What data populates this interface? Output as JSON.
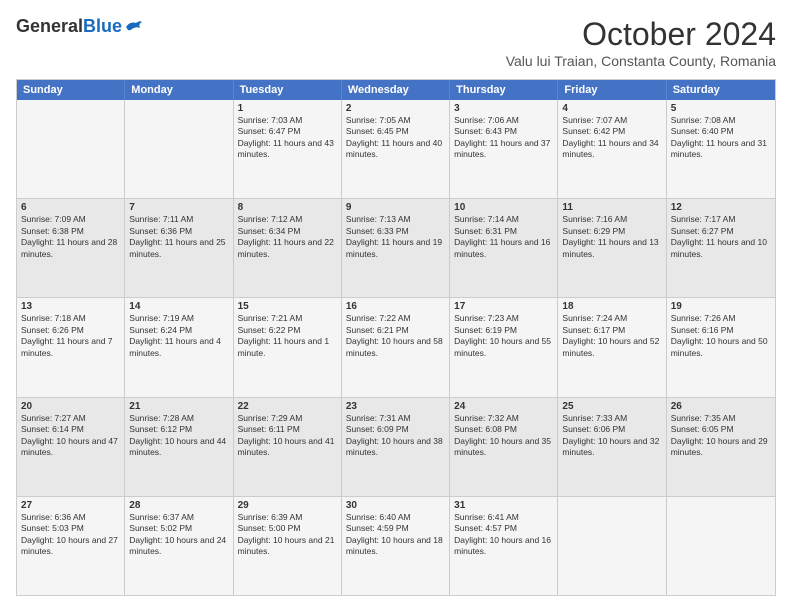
{
  "logo": {
    "general": "General",
    "blue": "Blue"
  },
  "title": "October 2024",
  "location": "Valu lui Traian, Constanta County, Romania",
  "headers": [
    "Sunday",
    "Monday",
    "Tuesday",
    "Wednesday",
    "Thursday",
    "Friday",
    "Saturday"
  ],
  "rows": [
    [
      {
        "day": "",
        "info": ""
      },
      {
        "day": "",
        "info": ""
      },
      {
        "day": "1",
        "info": "Sunrise: 7:03 AM\nSunset: 6:47 PM\nDaylight: 11 hours and 43 minutes."
      },
      {
        "day": "2",
        "info": "Sunrise: 7:05 AM\nSunset: 6:45 PM\nDaylight: 11 hours and 40 minutes."
      },
      {
        "day": "3",
        "info": "Sunrise: 7:06 AM\nSunset: 6:43 PM\nDaylight: 11 hours and 37 minutes."
      },
      {
        "day": "4",
        "info": "Sunrise: 7:07 AM\nSunset: 6:42 PM\nDaylight: 11 hours and 34 minutes."
      },
      {
        "day": "5",
        "info": "Sunrise: 7:08 AM\nSunset: 6:40 PM\nDaylight: 11 hours and 31 minutes."
      }
    ],
    [
      {
        "day": "6",
        "info": "Sunrise: 7:09 AM\nSunset: 6:38 PM\nDaylight: 11 hours and 28 minutes."
      },
      {
        "day": "7",
        "info": "Sunrise: 7:11 AM\nSunset: 6:36 PM\nDaylight: 11 hours and 25 minutes."
      },
      {
        "day": "8",
        "info": "Sunrise: 7:12 AM\nSunset: 6:34 PM\nDaylight: 11 hours and 22 minutes."
      },
      {
        "day": "9",
        "info": "Sunrise: 7:13 AM\nSunset: 6:33 PM\nDaylight: 11 hours and 19 minutes."
      },
      {
        "day": "10",
        "info": "Sunrise: 7:14 AM\nSunset: 6:31 PM\nDaylight: 11 hours and 16 minutes."
      },
      {
        "day": "11",
        "info": "Sunrise: 7:16 AM\nSunset: 6:29 PM\nDaylight: 11 hours and 13 minutes."
      },
      {
        "day": "12",
        "info": "Sunrise: 7:17 AM\nSunset: 6:27 PM\nDaylight: 11 hours and 10 minutes."
      }
    ],
    [
      {
        "day": "13",
        "info": "Sunrise: 7:18 AM\nSunset: 6:26 PM\nDaylight: 11 hours and 7 minutes."
      },
      {
        "day": "14",
        "info": "Sunrise: 7:19 AM\nSunset: 6:24 PM\nDaylight: 11 hours and 4 minutes."
      },
      {
        "day": "15",
        "info": "Sunrise: 7:21 AM\nSunset: 6:22 PM\nDaylight: 11 hours and 1 minute."
      },
      {
        "day": "16",
        "info": "Sunrise: 7:22 AM\nSunset: 6:21 PM\nDaylight: 10 hours and 58 minutes."
      },
      {
        "day": "17",
        "info": "Sunrise: 7:23 AM\nSunset: 6:19 PM\nDaylight: 10 hours and 55 minutes."
      },
      {
        "day": "18",
        "info": "Sunrise: 7:24 AM\nSunset: 6:17 PM\nDaylight: 10 hours and 52 minutes."
      },
      {
        "day": "19",
        "info": "Sunrise: 7:26 AM\nSunset: 6:16 PM\nDaylight: 10 hours and 50 minutes."
      }
    ],
    [
      {
        "day": "20",
        "info": "Sunrise: 7:27 AM\nSunset: 6:14 PM\nDaylight: 10 hours and 47 minutes."
      },
      {
        "day": "21",
        "info": "Sunrise: 7:28 AM\nSunset: 6:12 PM\nDaylight: 10 hours and 44 minutes."
      },
      {
        "day": "22",
        "info": "Sunrise: 7:29 AM\nSunset: 6:11 PM\nDaylight: 10 hours and 41 minutes."
      },
      {
        "day": "23",
        "info": "Sunrise: 7:31 AM\nSunset: 6:09 PM\nDaylight: 10 hours and 38 minutes."
      },
      {
        "day": "24",
        "info": "Sunrise: 7:32 AM\nSunset: 6:08 PM\nDaylight: 10 hours and 35 minutes."
      },
      {
        "day": "25",
        "info": "Sunrise: 7:33 AM\nSunset: 6:06 PM\nDaylight: 10 hours and 32 minutes."
      },
      {
        "day": "26",
        "info": "Sunrise: 7:35 AM\nSunset: 6:05 PM\nDaylight: 10 hours and 29 minutes."
      }
    ],
    [
      {
        "day": "27",
        "info": "Sunrise: 6:36 AM\nSunset: 5:03 PM\nDaylight: 10 hours and 27 minutes."
      },
      {
        "day": "28",
        "info": "Sunrise: 6:37 AM\nSunset: 5:02 PM\nDaylight: 10 hours and 24 minutes."
      },
      {
        "day": "29",
        "info": "Sunrise: 6:39 AM\nSunset: 5:00 PM\nDaylight: 10 hours and 21 minutes."
      },
      {
        "day": "30",
        "info": "Sunrise: 6:40 AM\nSunset: 4:59 PM\nDaylight: 10 hours and 18 minutes."
      },
      {
        "day": "31",
        "info": "Sunrise: 6:41 AM\nSunset: 4:57 PM\nDaylight: 10 hours and 16 minutes."
      },
      {
        "day": "",
        "info": ""
      },
      {
        "day": "",
        "info": ""
      }
    ]
  ]
}
